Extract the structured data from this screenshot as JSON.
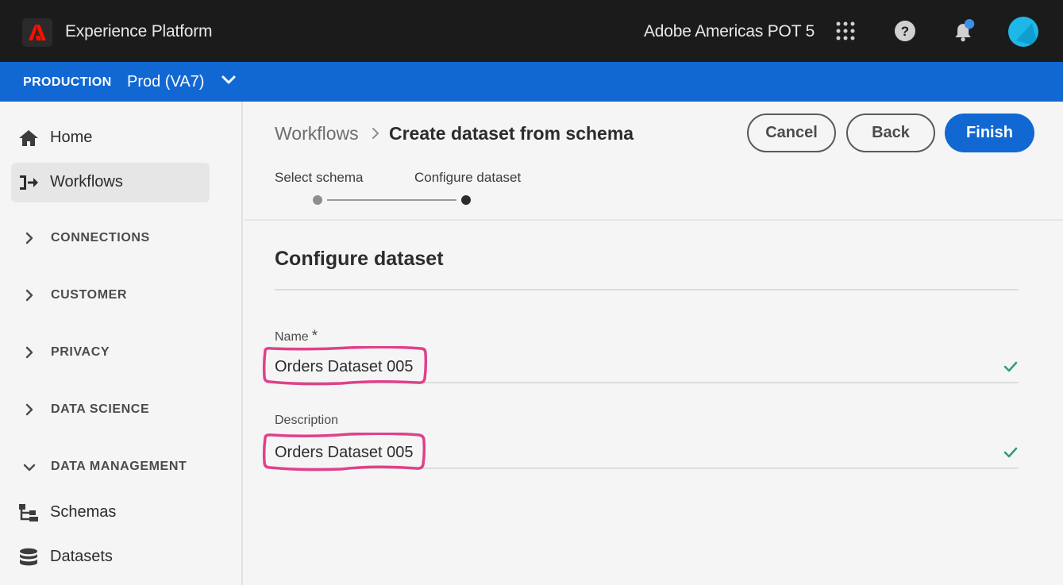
{
  "topbar": {
    "app_title": "Experience Platform",
    "org_name": "Adobe Americas POT 5",
    "icons": [
      "adobe-logo",
      "apps-grid-icon",
      "help-icon",
      "notification-bell-icon",
      "user-avatar"
    ]
  },
  "sandbox": {
    "environment": "PRODUCTION",
    "name": "Prod (VA7)"
  },
  "sidebar": {
    "items": [
      {
        "label": "Home",
        "icon": "home-icon",
        "active": false
      },
      {
        "label": "Workflows",
        "icon": "workflows-icon",
        "active": true
      }
    ],
    "sections": [
      {
        "label": "CONNECTIONS",
        "expanded": false
      },
      {
        "label": "CUSTOMER",
        "expanded": false
      },
      {
        "label": "PRIVACY",
        "expanded": false
      },
      {
        "label": "DATA SCIENCE",
        "expanded": false
      },
      {
        "label": "DATA MANAGEMENT",
        "expanded": true
      }
    ],
    "sub_items": [
      {
        "label": "Schemas",
        "icon": "schema-icon"
      },
      {
        "label": "Datasets",
        "icon": "database-icon"
      }
    ]
  },
  "breadcrumb": {
    "parent": "Workflows",
    "current": "Create dataset from schema"
  },
  "actions": {
    "cancel": "Cancel",
    "back": "Back",
    "finish": "Finish"
  },
  "stepper": {
    "steps": [
      "Select schema",
      "Configure dataset"
    ],
    "current_step": 2
  },
  "form": {
    "title": "Configure dataset",
    "name_label": "Name",
    "name_required_marker": "*",
    "name_value": "Orders Dataset 005",
    "description_label": "Description",
    "description_value": "Orders Dataset 005"
  },
  "colors": {
    "topbar_bg": "#1b1b1b",
    "sandbox_bar_bg": "#1268d3",
    "primary_button": "#1268d3",
    "valid_check": "#2d9d78",
    "annotation_highlight": "#e0418a"
  }
}
